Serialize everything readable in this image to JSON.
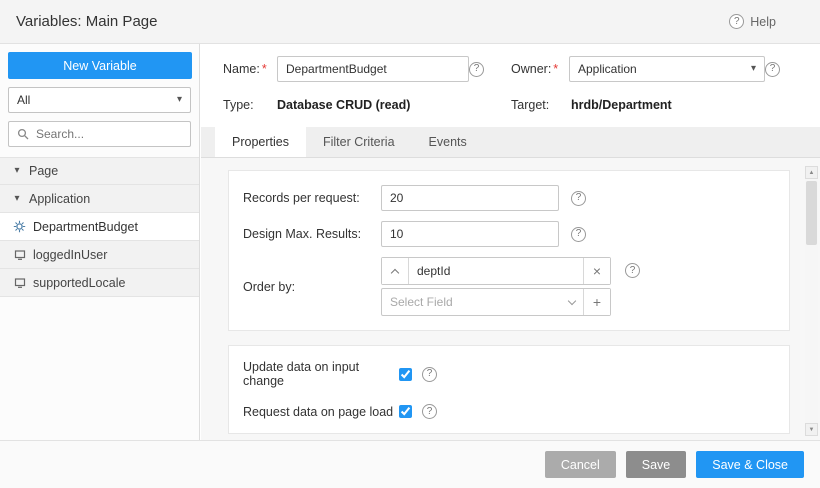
{
  "header": {
    "title": "Variables: Main Page",
    "help_label": "Help"
  },
  "sidebar": {
    "new_variable_label": "New Variable",
    "filter_selected": "All",
    "search_placeholder": "Search...",
    "tree": {
      "groups": [
        {
          "label": "Page"
        },
        {
          "label": "Application"
        }
      ],
      "items": [
        {
          "label": "DepartmentBudget",
          "selected": true
        },
        {
          "label": "loggedInUser",
          "selected": false
        },
        {
          "label": "supportedLocale",
          "selected": false
        }
      ]
    }
  },
  "form": {
    "required_marker": "*",
    "name_label": "Name:",
    "name_value": "DepartmentBudget",
    "owner_label": "Owner:",
    "owner_value": "Application",
    "type_label": "Type:",
    "type_value": "Database CRUD (read)",
    "target_label": "Target:",
    "target_value": "hrdb/Department"
  },
  "tabs": {
    "properties": "Properties",
    "filter_criteria": "Filter Criteria",
    "events": "Events"
  },
  "properties_panel": {
    "records_per_request_label": "Records per request:",
    "records_per_request_value": "20",
    "design_max_results_label": "Design Max. Results:",
    "design_max_results_value": "10",
    "order_by_label": "Order by:",
    "order_by_field": "deptId",
    "select_field_placeholder": "Select Field",
    "update_data_label": "Update data on input change",
    "update_data_checked": true,
    "request_data_label": "Request data on page load",
    "request_data_checked": true
  },
  "footer": {
    "cancel_label": "Cancel",
    "save_label": "Save",
    "save_close_label": "Save & Close"
  },
  "icons": {
    "question": "?",
    "caret_down": "▾",
    "triangle_up": "▲",
    "triangle_down": "▼",
    "close": "×",
    "plus": "+"
  },
  "colors": {
    "accent": "#2196f3",
    "required": "#e53935"
  }
}
